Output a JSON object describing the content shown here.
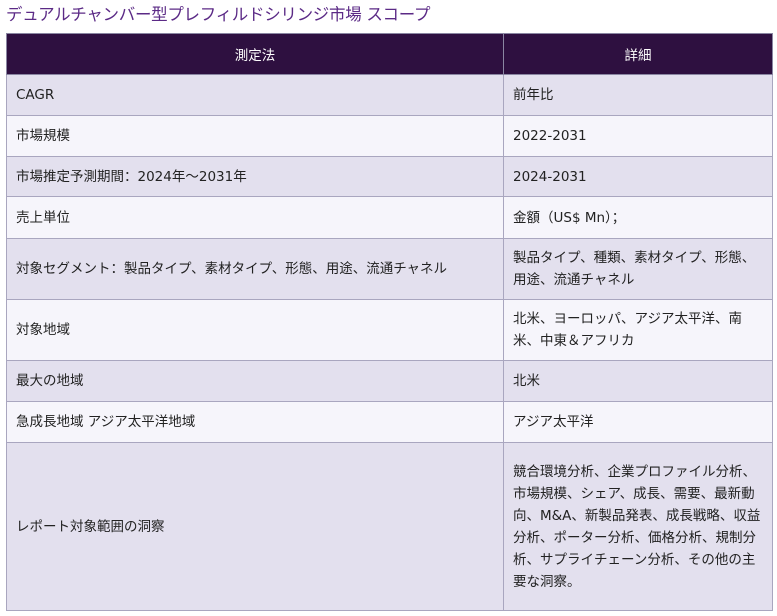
{
  "title": "デュアルチャンバー型プレフィルドシリンジ市場 スコープ",
  "table": {
    "headers": [
      "測定法",
      "詳細"
    ],
    "rows": [
      {
        "measure": "CAGR",
        "detail": "前年比"
      },
      {
        "measure": "市場規模",
        "detail": "2022-2031"
      },
      {
        "measure": "市場推定予測期間：2024年～2031年",
        "detail": "2024-2031"
      },
      {
        "measure": "売上単位",
        "detail": "金額（US$ Mn）；"
      },
      {
        "measure": "対象セグメント：製品タイプ、素材タイプ、形態、用途、流通チャネル",
        "detail": "製品タイプ、種類、素材タイプ、形態、用途、流通チャネル"
      },
      {
        "measure": "対象地域",
        "detail": "北米、ヨーロッパ、アジア太平洋、南米、中東＆アフリカ"
      },
      {
        "measure": "最大の地域",
        "detail": "北米"
      },
      {
        "measure": "急成長地域 アジア太平洋地域",
        "detail": "アジア太平洋"
      },
      {
        "measure": "レポート対象範囲の洞察",
        "detail": "競合環境分析、企業プロファイル分析、市場規模、シェア、成長、需要、最新動向、M&A、新製品発表、成長戦略、収益分析、ポーター分析、価格分析、規制分析、サプライチェーン分析、その他の主要な洞察。"
      }
    ]
  }
}
